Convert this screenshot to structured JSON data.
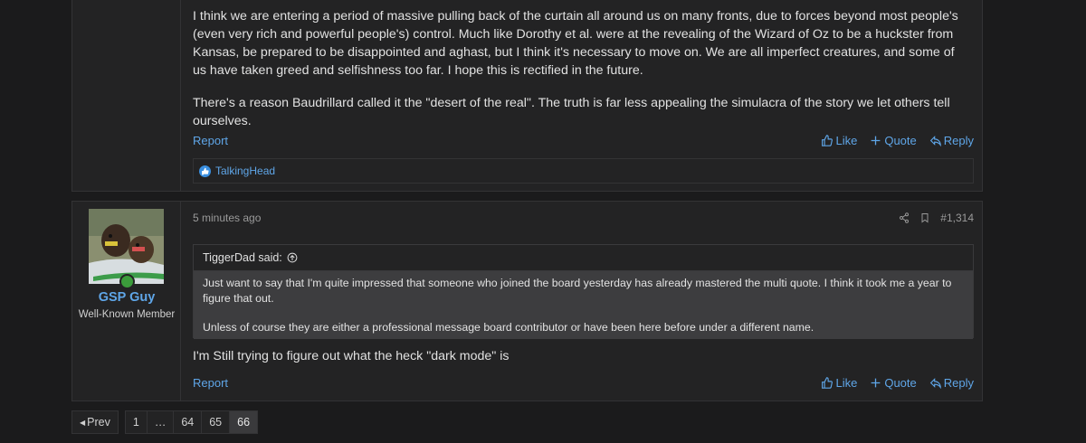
{
  "post1": {
    "paragraphs": [
      "I think we are entering a period of massive pulling back of the curtain all around us on many fronts, due to forces beyond most people's (even very rich and powerful people's) control. Much like Dorothy et al. were at the revealing of the Wizard of Oz to be a huckster from Kansas, be prepared to be disappointed and aghast, but I think it's necessary to move on. We are all imperfect creatures, and some of us have taken greed and selfishness too far. I hope this is rectified in the future.",
      "There's a reason Baudrillard called it the \"desert of the real\". The truth is far less appealing the simulacra of the story we let others tell ourselves."
    ],
    "report_label": "Report",
    "like_label": "Like",
    "quote_label": "Quote",
    "reply_label": "Reply",
    "reaction_user": "TalkingHead"
  },
  "post2": {
    "username": "GSP Guy",
    "user_title": "Well-Known Member",
    "time": "5 minutes ago",
    "post_number": "#1,314",
    "quote": {
      "author": "TiggerDad said:",
      "paragraphs": [
        "Just want to say that I'm quite impressed that someone who joined the board yesterday has already mastered the multi quote. I think it took me a year to figure that out.",
        "Unless of course they are either a professional message board contributor or have been here before under a different name."
      ]
    },
    "body": "I'm Still trying to figure out what the heck \"dark mode\" is",
    "report_label": "Report",
    "like_label": "Like",
    "quote_label": "Quote",
    "reply_label": "Reply"
  },
  "pager": {
    "prev_label": "Prev",
    "pages": [
      "1",
      "…",
      "64",
      "65",
      "66"
    ],
    "current": "66"
  },
  "colors": {
    "background": "#1b1b1c",
    "panel": "#232324",
    "link": "#5fa6e8",
    "quote_body": "#3d3d3f"
  }
}
